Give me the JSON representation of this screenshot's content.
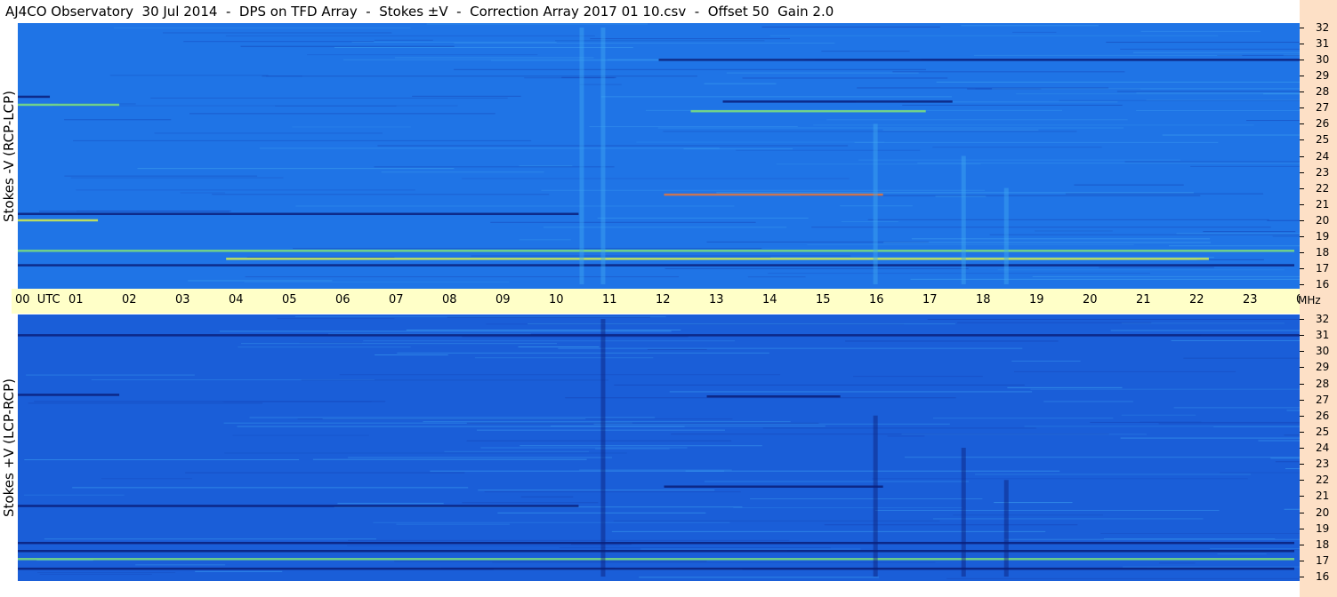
{
  "title": "AJ4CO Observatory  30 Jul 2014  -  DPS on TFD Array  -  Stokes ±V  -  Correction Array 2017 01 10.csv  -  Offset 50  Gain 2.0",
  "panels": {
    "top": {
      "ylabel": "Stokes -V (RCP-LCP)"
    },
    "bottom": {
      "ylabel": "Stokes +V (LCP-RCP)"
    }
  },
  "time_axis": {
    "ticks": [
      "00  UTC",
      "01",
      "02",
      "03",
      "04",
      "05",
      "06",
      "07",
      "08",
      "09",
      "10",
      "11",
      "12",
      "13",
      "14",
      "15",
      "16",
      "17",
      "18",
      "19",
      "20",
      "21",
      "22",
      "23",
      "00"
    ]
  },
  "freq_axis": {
    "unit": "MHz",
    "ticks": [
      "32",
      "31",
      "30",
      "29",
      "28",
      "27",
      "26",
      "25",
      "24",
      "23",
      "22",
      "21",
      "20",
      "19",
      "18",
      "17",
      "16"
    ]
  },
  "colors": {
    "background_blue": "#1f74e6",
    "bottom_blue": "#1a5ed8",
    "axis_band": "#ffffc8",
    "right_strip": "#fde0c6"
  },
  "chart_data": {
    "type": "heatmap",
    "title": "AJ4CO Observatory  30 Jul 2014  -  DPS on TFD Array  -  Stokes ±V  -  Correction Array 2017 01 10.csv  -  Offset 50  Gain 2.0",
    "x_range_hours": [
      0,
      24
    ],
    "y_range_mhz": [
      16,
      32
    ],
    "panels": [
      {
        "name": "Stokes -V (RCP-LCP)",
        "features": [
          {
            "kind": "band",
            "mhz": 27.2,
            "t0": 0.0,
            "t1": 1.9,
            "tone": "green"
          },
          {
            "kind": "band",
            "mhz": 26.8,
            "t0": 12.6,
            "t1": 17.0,
            "tone": "green"
          },
          {
            "kind": "band",
            "mhz": 21.6,
            "t0": 12.1,
            "t1": 16.2,
            "tone": "red"
          },
          {
            "kind": "band",
            "mhz": 20.0,
            "t0": 0.0,
            "t1": 1.5,
            "tone": "yellow"
          },
          {
            "kind": "band",
            "mhz": 17.6,
            "t0": 3.9,
            "t1": 22.3,
            "tone": "yellow"
          },
          {
            "kind": "band",
            "mhz": 18.1,
            "t0": 0.0,
            "t1": 23.9,
            "tone": "green"
          },
          {
            "kind": "band",
            "mhz": 17.2,
            "t0": 0.0,
            "t1": 23.9,
            "tone": "dark"
          },
          {
            "kind": "band",
            "mhz": 27.7,
            "t0": 0.0,
            "t1": 0.6,
            "tone": "dark"
          },
          {
            "kind": "band",
            "mhz": 27.4,
            "t0": 13.2,
            "t1": 17.5,
            "tone": "dark"
          },
          {
            "kind": "band",
            "mhz": 20.4,
            "t0": 0.0,
            "t1": 10.5,
            "tone": "dark"
          },
          {
            "kind": "band",
            "mhz": 30.0,
            "t0": 12.0,
            "t1": 24.0,
            "tone": "dark"
          },
          {
            "kind": "vline",
            "t": 10.95,
            "mhz0": 16,
            "mhz1": 32,
            "tone": "light"
          },
          {
            "kind": "vline",
            "t": 10.55,
            "mhz0": 16,
            "mhz1": 32,
            "tone": "light"
          },
          {
            "kind": "vline",
            "t": 16.05,
            "mhz0": 16,
            "mhz1": 26,
            "tone": "light"
          },
          {
            "kind": "vline",
            "t": 17.7,
            "mhz0": 16,
            "mhz1": 24,
            "tone": "light"
          },
          {
            "kind": "vline",
            "t": 18.5,
            "mhz0": 16,
            "mhz1": 22,
            "tone": "light"
          }
        ]
      },
      {
        "name": "Stokes +V (LCP-RCP)",
        "features": [
          {
            "kind": "band",
            "mhz": 27.3,
            "t0": 0.0,
            "t1": 1.9,
            "tone": "dark"
          },
          {
            "kind": "band",
            "mhz": 27.2,
            "t0": 12.9,
            "t1": 15.4,
            "tone": "dark"
          },
          {
            "kind": "band",
            "mhz": 21.6,
            "t0": 12.1,
            "t1": 16.2,
            "tone": "dark"
          },
          {
            "kind": "band",
            "mhz": 17.6,
            "t0": 0.0,
            "t1": 23.9,
            "tone": "dark"
          },
          {
            "kind": "band",
            "mhz": 17.1,
            "t0": 0.0,
            "t1": 23.9,
            "tone": "green"
          },
          {
            "kind": "band",
            "mhz": 16.5,
            "t0": 0.0,
            "t1": 23.9,
            "tone": "dark"
          },
          {
            "kind": "band",
            "mhz": 18.1,
            "t0": 0.0,
            "t1": 23.9,
            "tone": "dark"
          },
          {
            "kind": "band",
            "mhz": 20.4,
            "t0": 0.0,
            "t1": 10.5,
            "tone": "dark"
          },
          {
            "kind": "band",
            "mhz": 31.0,
            "t0": 0.0,
            "t1": 24.0,
            "tone": "dark"
          },
          {
            "kind": "vline",
            "t": 10.95,
            "mhz0": 16,
            "mhz1": 32,
            "tone": "dark"
          },
          {
            "kind": "vline",
            "t": 16.05,
            "mhz0": 16,
            "mhz1": 26,
            "tone": "dark"
          },
          {
            "kind": "vline",
            "t": 17.7,
            "mhz0": 16,
            "mhz1": 24,
            "tone": "dark"
          },
          {
            "kind": "vline",
            "t": 18.5,
            "mhz0": 16,
            "mhz1": 22,
            "tone": "dark"
          }
        ]
      }
    ]
  }
}
